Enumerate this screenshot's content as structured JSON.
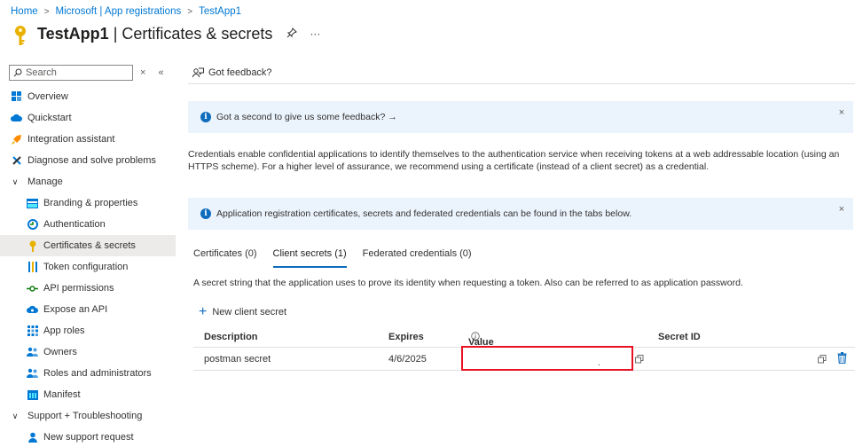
{
  "breadcrumb": {
    "items": [
      "Home",
      "Microsoft | App registrations",
      "TestApp1"
    ]
  },
  "header": {
    "app_name": "TestApp1",
    "separator": " | ",
    "page_name": "Certificates & secrets",
    "pin_icon": "pin-icon",
    "more_icon": "ellipsis-icon",
    "more_text": "···"
  },
  "sidebar": {
    "search_placeholder": "Search",
    "clear_text": "×",
    "collapse_text": "«",
    "items": [
      {
        "label": "Overview",
        "icon": "overview-grid-icon"
      },
      {
        "label": "Quickstart",
        "icon": "cloud-icon"
      },
      {
        "label": "Integration assistant",
        "icon": "rocket-icon"
      },
      {
        "label": "Diagnose and solve problems",
        "icon": "wrench-icon"
      },
      {
        "label": "Manage",
        "icon": "chevron-down-icon",
        "chevron": "∨"
      },
      {
        "label": "Branding & properties",
        "icon": "branding-icon"
      },
      {
        "label": "Authentication",
        "icon": "authentication-icon"
      },
      {
        "label": "Certificates & secrets",
        "icon": "key-icon"
      },
      {
        "label": "Token configuration",
        "icon": "token-bars-icon"
      },
      {
        "label": "API permissions",
        "icon": "api-permissions-icon"
      },
      {
        "label": "Expose an API",
        "icon": "cloud-api-icon"
      },
      {
        "label": "App roles",
        "icon": "app-roles-grid-icon"
      },
      {
        "label": "Owners",
        "icon": "owners-people-icon"
      },
      {
        "label": "Roles and administrators",
        "icon": "roles-people-icon"
      },
      {
        "label": "Manifest",
        "icon": "manifest-icon"
      },
      {
        "label": "Support + Troubleshooting",
        "icon": "chevron-down-icon",
        "chevron": "∨"
      },
      {
        "label": "New support request",
        "icon": "support-person-icon"
      }
    ]
  },
  "toolbar": {
    "feedback_label": "Got feedback?"
  },
  "banners": {
    "feedback": {
      "text": "Got a second to give us some feedback? →",
      "close": "×"
    },
    "info": {
      "text": "Application registration certificates, secrets and federated credentials can be found in the tabs below.",
      "close": "×"
    },
    "info_glyph": "i"
  },
  "description": "Credentials enable confidential applications to identify themselves to the authentication service when receiving tokens at a web addressable location (using an HTTPS scheme). For a higher level of assurance, we recommend using a certificate (instead of a client secret) as a credential.",
  "tabs": [
    {
      "label": "Certificates (0)",
      "active": false
    },
    {
      "label": "Client secrets (1)",
      "active": true
    },
    {
      "label": "Federated credentials (0)",
      "active": false
    }
  ],
  "client_secrets": {
    "description": "A secret string that the application uses to prove its identity when requesting a token. Also can be referred to as application password.",
    "new_button": "New client secret",
    "new_glyph": "+",
    "columns": [
      "Description",
      "Expires",
      "Value",
      "Secret ID"
    ],
    "rows": [
      {
        "description": "postman secret",
        "expires": "4/6/2025",
        "value": ".",
        "secret_id": ""
      }
    ]
  },
  "colors": {
    "accent": "#0f6cbd",
    "highlight_box": "#e81123",
    "banner_bg": "#ebf3fc",
    "key_gold": "#e8b100"
  }
}
